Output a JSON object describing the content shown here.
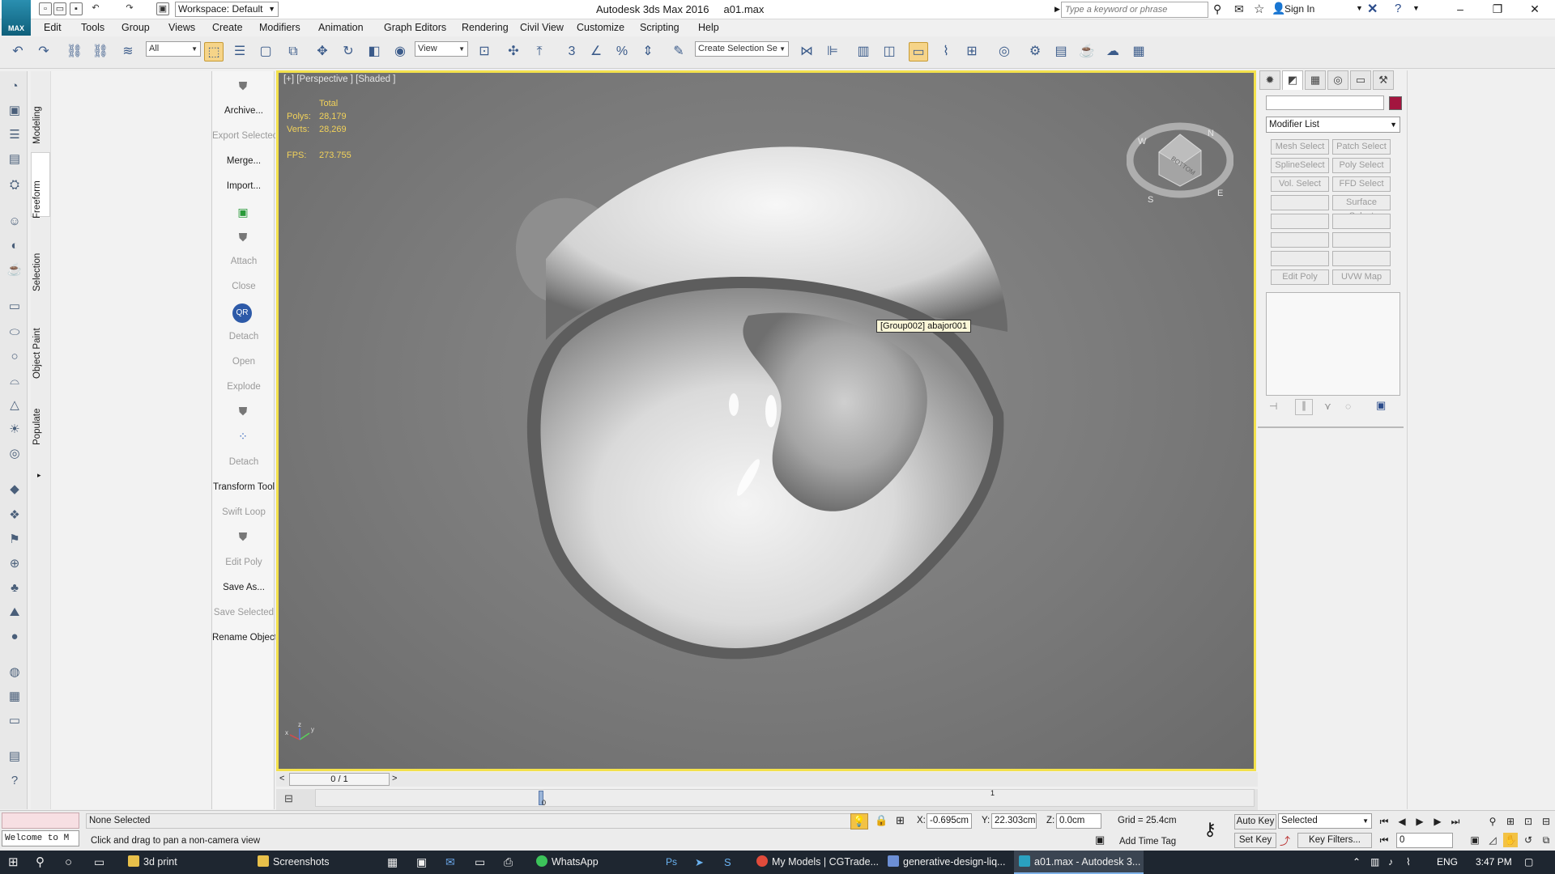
{
  "titlebar": {
    "app_label": "MAX",
    "workspace": "Workspace: Default",
    "window_title": "Autodesk 3ds Max 2016     a01.max",
    "search_placeholder": "Type a keyword or phrase",
    "sign_in": "Sign In"
  },
  "menu": [
    "Edit",
    "Tools",
    "Group",
    "Views",
    "Create",
    "Modifiers",
    "Animation",
    "Graph Editors",
    "Rendering",
    "Civil View",
    "Customize",
    "Scripting",
    "Help"
  ],
  "toolbar": {
    "selection_filter": "All",
    "ref_coord": "View",
    "named_selection_placeholder": "Create Selection Se"
  },
  "ribbon_tabs": [
    "Modeling",
    "Freeform",
    "Selection",
    "Object Paint",
    "Populate"
  ],
  "ribbon_panel": [
    {
      "label": "Archive...",
      "disabled": false
    },
    {
      "label": "Export Selected",
      "disabled": true
    },
    {
      "label": "Merge...",
      "disabled": false
    },
    {
      "label": "Import...",
      "disabled": false
    },
    {
      "label": "Attach",
      "disabled": true
    },
    {
      "label": "Close",
      "disabled": true
    },
    {
      "label": "Detach",
      "disabled": true
    },
    {
      "label": "Open",
      "disabled": true
    },
    {
      "label": "Explode",
      "disabled": true
    },
    {
      "label": "Detach",
      "disabled": true
    },
    {
      "label": "Transform Tool",
      "disabled": false
    },
    {
      "label": "Swift Loop",
      "disabled": true
    },
    {
      "label": "Edit Poly",
      "disabled": true
    },
    {
      "label": "Save As...",
      "disabled": false
    },
    {
      "label": "Save Selected",
      "disabled": true
    },
    {
      "label": "Rename Objects",
      "disabled": false
    }
  ],
  "viewport": {
    "label": "[+] [Perspective ] [Shaded ]",
    "stats_header": "Total",
    "polys_label": "Polys:",
    "polys": "28,179",
    "verts_label": "Verts:",
    "verts": "28,269",
    "fps_label": "FPS:",
    "fps": "273.755",
    "tooltip": "[Group002] abajor001",
    "viewcube_face": "BOTTOM",
    "viewcube_letters": [
      "N",
      "E",
      "S",
      "W"
    ],
    "axes": [
      "x",
      "y",
      "z"
    ]
  },
  "command_panel": {
    "modifier_list": "Modifier List",
    "modifier_buttons": [
      "Mesh Select",
      "Patch Select",
      "SplineSelect",
      "Poly Select",
      "Vol. Select",
      "FFD Select",
      "",
      "Surface Select",
      "",
      "",
      "",
      "",
      "",
      "",
      "Edit Poly",
      "UVW Map"
    ],
    "object_color": "#a3153f"
  },
  "timeline": {
    "frame_counter": "0 / 1",
    "prev": "<",
    "next": ">",
    "tick0": "0",
    "tick1": "1"
  },
  "statusbar": {
    "listener": "Welcome to M",
    "selection": "None Selected",
    "prompt": "Click and drag to pan a non-camera view",
    "x_label": "X:",
    "x_value": "-0.695cm",
    "y_label": "Y:",
    "y_value": "22.303cm",
    "z_label": "Z:",
    "z_value": "0.0cm",
    "grid": "Grid = 25.4cm",
    "add_time_tag": "Add Time Tag",
    "auto_key": "Auto Key",
    "set_key": "Set Key",
    "key_mode": "Selected",
    "key_filters": "Key Filters...",
    "current_frame": "0"
  },
  "taskbar": {
    "tasks": [
      {
        "label": "3d print",
        "color": "#e8c04a",
        "active": false
      },
      {
        "label": "Screenshots",
        "color": "#e8c04a",
        "active": false
      },
      {
        "label": "WhatsApp",
        "color": "#3cc35a",
        "active": false
      },
      {
        "label": "My Models | CGTrade...",
        "color": "#e14b3b",
        "active": false
      },
      {
        "label": "generative-design-liq...",
        "color": "#6c8fd4",
        "active": false
      },
      {
        "label": "a01.max - Autodesk 3...",
        "color": "#2aa1c0",
        "active": true
      }
    ],
    "lang": "ENG",
    "time": "3:47 PM"
  }
}
